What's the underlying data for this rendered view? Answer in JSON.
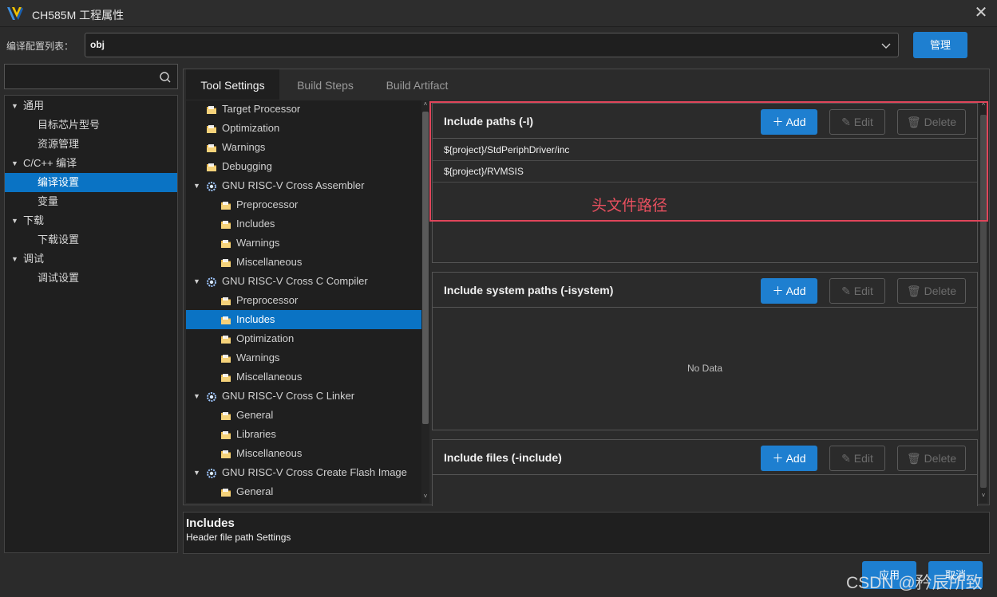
{
  "window": {
    "title": "CH585M 工程属性",
    "close_icon": "close-icon"
  },
  "config": {
    "label": "编译配置列表：",
    "value": "obj",
    "manage_label": "管理"
  },
  "search": {
    "placeholder": ""
  },
  "left_tree": {
    "items": [
      {
        "label": "通用",
        "level": 0,
        "expanded": true
      },
      {
        "label": "目标芯片型号",
        "level": 1
      },
      {
        "label": "资源管理",
        "level": 1
      },
      {
        "label": "C/C++ 编译",
        "level": 0,
        "expanded": true
      },
      {
        "label": "编译设置",
        "level": 1,
        "selected": true
      },
      {
        "label": "变量",
        "level": 1
      },
      {
        "label": "下载",
        "level": 0,
        "expanded": true
      },
      {
        "label": "下载设置",
        "level": 1
      },
      {
        "label": "调试",
        "level": 0,
        "expanded": true
      },
      {
        "label": "调试设置",
        "level": 1
      }
    ]
  },
  "tabs": [
    {
      "label": "Tool Settings",
      "active": true
    },
    {
      "label": "Build Steps",
      "active": false
    },
    {
      "label": "Build Artifact",
      "active": false
    }
  ],
  "tool_tree": {
    "items": [
      {
        "label": "Target Processor",
        "level": 0,
        "kind": "folder"
      },
      {
        "label": "Optimization",
        "level": 0,
        "kind": "folder"
      },
      {
        "label": "Warnings",
        "level": 0,
        "kind": "folder"
      },
      {
        "label": "Debugging",
        "level": 0,
        "kind": "folder"
      },
      {
        "label": "GNU RISC-V Cross Assembler",
        "level": 0,
        "kind": "tool",
        "expanded": true
      },
      {
        "label": "Preprocessor",
        "level": 1,
        "kind": "folder"
      },
      {
        "label": "Includes",
        "level": 1,
        "kind": "folder"
      },
      {
        "label": "Warnings",
        "level": 1,
        "kind": "folder"
      },
      {
        "label": "Miscellaneous",
        "level": 1,
        "kind": "folder"
      },
      {
        "label": "GNU RISC-V Cross C Compiler",
        "level": 0,
        "kind": "tool",
        "expanded": true
      },
      {
        "label": "Preprocessor",
        "level": 1,
        "kind": "folder"
      },
      {
        "label": "Includes",
        "level": 1,
        "kind": "folder",
        "selected": true
      },
      {
        "label": "Optimization",
        "level": 1,
        "kind": "folder"
      },
      {
        "label": "Warnings",
        "level": 1,
        "kind": "folder"
      },
      {
        "label": "Miscellaneous",
        "level": 1,
        "kind": "folder"
      },
      {
        "label": "GNU RISC-V Cross C Linker",
        "level": 0,
        "kind": "tool",
        "expanded": true
      },
      {
        "label": "General",
        "level": 1,
        "kind": "folder"
      },
      {
        "label": "Libraries",
        "level": 1,
        "kind": "folder"
      },
      {
        "label": "Miscellaneous",
        "level": 1,
        "kind": "folder"
      },
      {
        "label": "GNU RISC-V Cross Create Flash Image",
        "level": 0,
        "kind": "tool",
        "expanded": true
      },
      {
        "label": "General",
        "level": 1,
        "kind": "folder"
      }
    ]
  },
  "sections": {
    "include_paths": {
      "title": "Include paths (-I)",
      "rows": [
        "${project}/StdPeriphDriver/inc",
        "${project}/RVMSIS"
      ]
    },
    "include_system_paths": {
      "title": "Include system paths (-isystem)",
      "empty_text": "No Data"
    },
    "include_files": {
      "title": "Include files (-include)"
    },
    "buttons": {
      "add": "Add",
      "edit": "Edit",
      "delete": "Delete"
    }
  },
  "annotation": {
    "text": "头文件路径",
    "color": "#e0455a"
  },
  "description": {
    "title": "Includes",
    "text": "Header file path Settings"
  },
  "footer": {
    "apply_label": "应用",
    "cancel_label": "取消"
  },
  "watermark": "CSDN @矜辰所致",
  "colors": {
    "accent": "#1e7fd0",
    "selection": "#0a73c4",
    "background": "#2b2b2b"
  }
}
